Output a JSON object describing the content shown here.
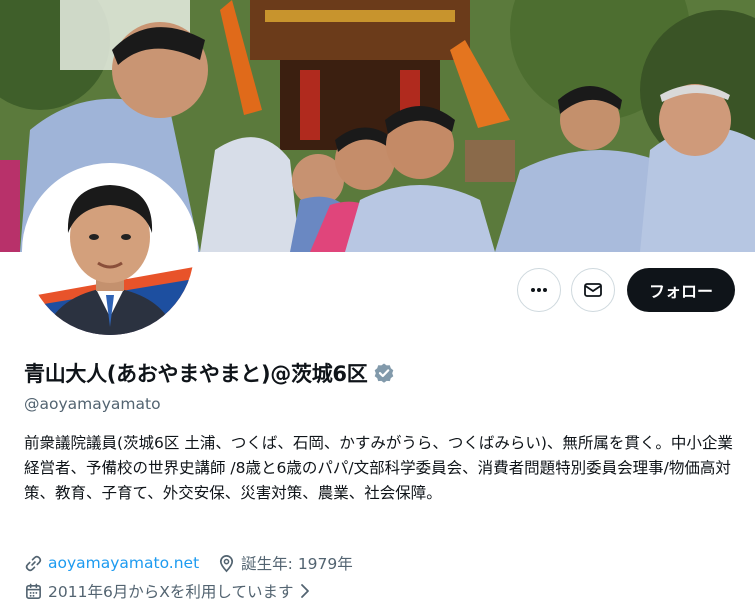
{
  "profile": {
    "display_name": "青山大人(あおやまやまと)@茨城6区",
    "handle": "@aoyamayamato",
    "bio": "前衆議院議員(茨城6区 土浦、つくば、石岡、かすみがうら、つくばみらい)、無所属を貫く。中小企業経営者、予備校の世界史講師 /8歳と6歳のパパ/文部科学委員会、消費者問題特別委員会理事/物価高対策、教育、子育て、外交安保、災害対策、農業、社会保障。",
    "website": "aoyamayamato.net",
    "birth": "誕生年: 1979年",
    "joined": "2011年6月からXを利用しています"
  },
  "actions": {
    "follow_label": "フォロー"
  },
  "icons": {
    "more": "more-horizontal-icon",
    "message": "envelope-icon",
    "verified": "verified-badge-icon",
    "link": "link-icon",
    "location": "location-pin-icon",
    "calendar": "calendar-icon",
    "chevron": "chevron-right-icon"
  },
  "colors": {
    "text": "#0f1419",
    "muted": "#536471",
    "link": "#1d9bf0",
    "follow_bg": "#0f1419",
    "border": "#cfd9de",
    "verified": "#829aab"
  }
}
